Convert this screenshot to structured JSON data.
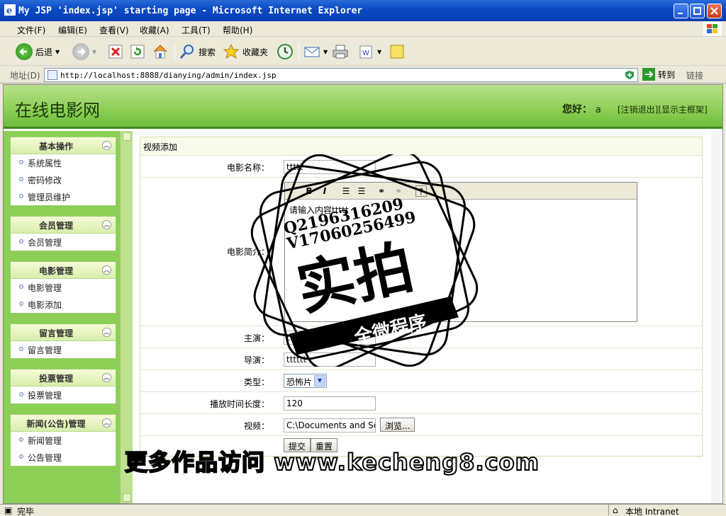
{
  "window": {
    "title": "My JSP 'index.jsp' starting page - Microsoft Internet Explorer"
  },
  "menu": [
    "文件(F)",
    "编辑(E)",
    "查看(V)",
    "收藏(A)",
    "工具(T)",
    "帮助(H)"
  ],
  "toolbar": {
    "back": "后退",
    "search": "搜索",
    "favorites": "收藏夹"
  },
  "address": {
    "label": "地址(D)",
    "url": "http://localhost:8888/dianying/admin/index.jsp",
    "go": "转到",
    "links": "链接"
  },
  "header": {
    "site_title": "在线电影网",
    "greeting": "您好：",
    "username": "a",
    "logout": "[注销退出]",
    "show_frame": "[显示主框架]"
  },
  "sidebar": {
    "groups": [
      {
        "title": "基本操作",
        "items": [
          "系统属性",
          "密码修改",
          "管理员维护"
        ]
      },
      {
        "title": "会员管理",
        "items": [
          "会员管理"
        ]
      },
      {
        "title": "电影管理",
        "items": [
          "电影管理",
          "电影添加"
        ]
      },
      {
        "title": "留言管理",
        "items": [
          "留言管理"
        ]
      },
      {
        "title": "投票管理",
        "items": [
          "投票管理"
        ]
      },
      {
        "title": "新闻(公告)管理",
        "items": [
          "新闻管理",
          "公告管理"
        ]
      }
    ]
  },
  "form": {
    "title": "视频添加",
    "name_label": "电影名称：",
    "name_value": "ttttt",
    "intro_label": "电影简介：",
    "intro_value": "请输入内容ttttt",
    "actor_label": "主演：",
    "actor_value": "tttttttt",
    "director_label": "导演：",
    "director_value": "tttttt",
    "type_label": "类型：",
    "type_value": "恐怖片",
    "duration_label": "播放时间长度：",
    "duration_value": "120",
    "video_label": "视频：",
    "video_value": "C:\\Documents and Sett",
    "browse": "浏览...",
    "submit": "提交",
    "reset": "重置"
  },
  "watermark": {
    "qq": "Q2196316209",
    "vx": "V17060256499",
    "main": "实拍",
    "banner": "全微程序",
    "bottom": "更多作品访问 www.kecheng8.com"
  },
  "status": {
    "left": "完毕",
    "zone": "本地 Intranet"
  }
}
